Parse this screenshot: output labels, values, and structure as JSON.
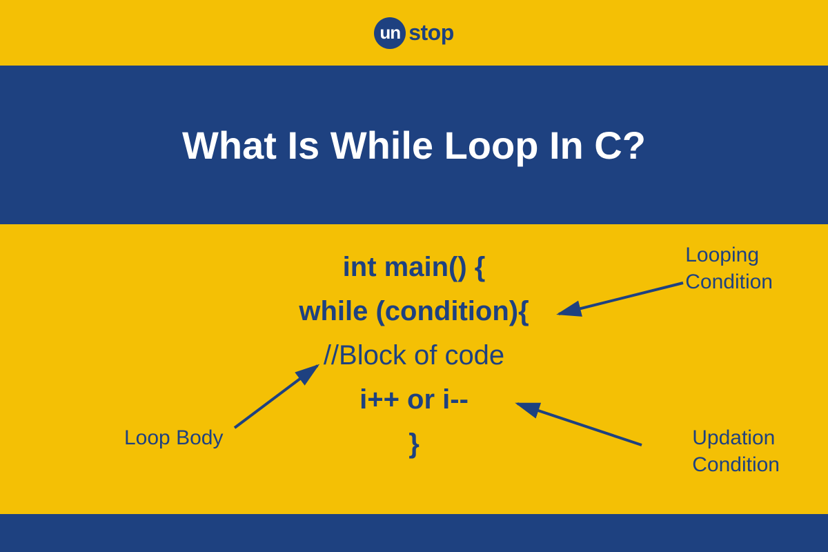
{
  "logo": {
    "circle_text": "un",
    "suffix_text": "stop"
  },
  "title": "What Is While Loop In C?",
  "code": {
    "line1": "int main() {",
    "line2": "while (condition){",
    "line3": "//Block of code",
    "line4": "i++ or i--",
    "line5": "}"
  },
  "annotations": {
    "looping_line1": "Looping",
    "looping_line2": "Condition",
    "loop_body": "Loop Body",
    "updation_line1": "Updation",
    "updation_line2": "Condition"
  },
  "colors": {
    "blue": "#1e4180",
    "yellow": "#f4c005",
    "white": "#ffffff"
  }
}
